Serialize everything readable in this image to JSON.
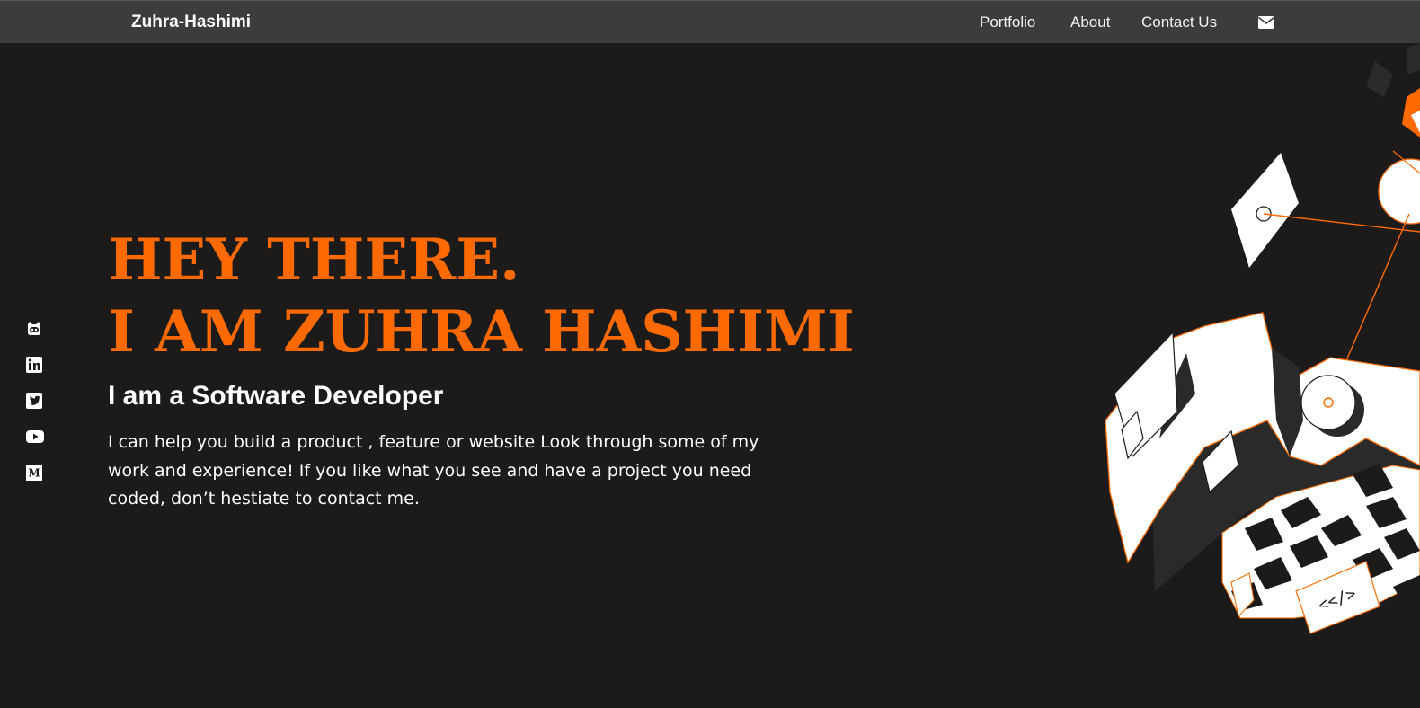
{
  "header": {
    "brand": "Zuhra-Hashimi",
    "nav": [
      {
        "label": "Portfolio"
      },
      {
        "label": "About"
      },
      {
        "label": "Contact Us"
      }
    ],
    "mail_icon": "envelope-icon"
  },
  "social": [
    {
      "icon": "github-icon"
    },
    {
      "icon": "linkedin-icon"
    },
    {
      "icon": "twitter-icon"
    },
    {
      "icon": "youtube-icon"
    },
    {
      "icon": "medium-icon"
    }
  ],
  "hero": {
    "line1": "HEY THERE.",
    "line2": "I AM ZUHRA HASHIMI",
    "subtitle": "I am a Software Developer",
    "description": "I can help you build a product , feature or website Look through some of my work and experience! If you like what you see and have a project you need coded, don’t hestiate to contact me."
  },
  "illustration": {
    "code_tag": "<</>",
    "accent": "#ff6a00"
  },
  "colors": {
    "background": "#1c1b1a",
    "navbar": "#3d3c3d",
    "accent": "#ff6a00",
    "text": "#ffffff"
  }
}
